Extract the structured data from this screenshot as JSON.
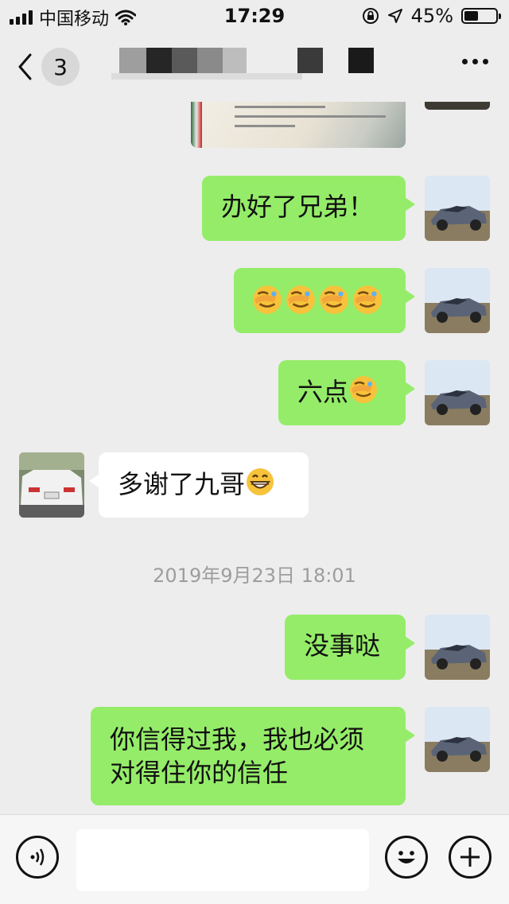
{
  "status_bar": {
    "carrier": "中国移动",
    "time": "17:29",
    "battery": "45%",
    "battery_level": 0.45
  },
  "header": {
    "back_badge": "3"
  },
  "messages": {
    "m1": "办好了兄弟！",
    "m2_emoji_count": 4,
    "m3": "六点",
    "m4": "多谢了九哥",
    "timestamp": "2019年9月23日 18:01",
    "m5": "没事哒",
    "m6_line1": "你信得过我，我也必须",
    "m6_line2": "对得住你的信任"
  },
  "icons": {
    "back": "chevron-left-icon",
    "more": "more-dots-icon",
    "voice": "voice-icon",
    "emoji": "emoji-icon",
    "plus": "plus-icon",
    "facepalm": "facepalm-emoji",
    "grin": "grin-emoji"
  },
  "colors": {
    "outgoing_bubble": "#95ec69",
    "incoming_bubble": "#ffffff",
    "background": "#ededed"
  }
}
